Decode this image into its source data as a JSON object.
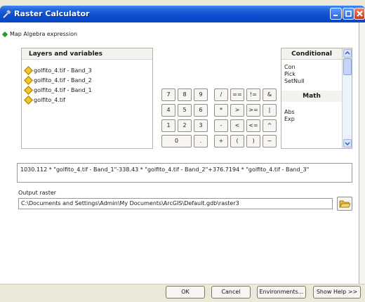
{
  "window": {
    "title": "Raster Calculator"
  },
  "expression_header": "Map Algebra expression",
  "layers_panel": {
    "header": "Layers and variables",
    "items": [
      "golfito_4.tif - Band_3",
      "golfito_4.tif - Band_2",
      "golfito_4.tif - Band_1",
      "golfito_4.tif"
    ]
  },
  "calculator": {
    "row1": [
      "7",
      "8",
      "9",
      "/",
      "==",
      "!=",
      "&"
    ],
    "row2": [
      "4",
      "5",
      "6",
      "*",
      ">",
      ">=",
      "|"
    ],
    "row3": [
      "1",
      "2",
      "3",
      "-",
      "<",
      "<=",
      "^"
    ],
    "row4": [
      "0",
      ".",
      "+",
      "(",
      ")",
      "~"
    ]
  },
  "tools_panel": {
    "conditional_header": "Conditional",
    "conditional_items": [
      "Con",
      "Pick",
      "SetNull"
    ],
    "math_header": "Math",
    "math_items": [
      "Abs",
      "Exp"
    ]
  },
  "expression_text": "1030.112 * \"golfito_4.tif - Band_1\"-338.43 * \"golfito_4.tif - Band_2\"+376.7194 * \"golfito_4.tif - Band_3\"",
  "output": {
    "label": "Output raster",
    "value": "C:\\Documents and Settings\\Admin\\My Documents\\ArcGIS\\Default.gdb\\raster3"
  },
  "footer": {
    "ok": "OK",
    "cancel": "Cancel",
    "environments": "Environments...",
    "show_help": "Show Help >>"
  },
  "colors": {
    "titlebar": "#0a4fd0",
    "dialog": "#ece9d8",
    "accent": "#f4c430"
  }
}
